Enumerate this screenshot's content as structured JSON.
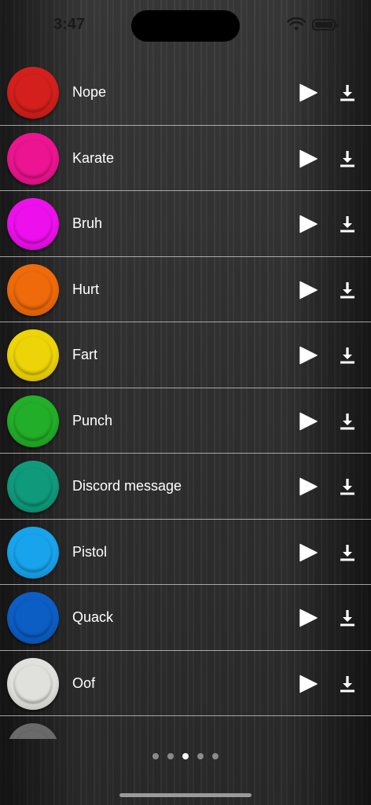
{
  "status_bar": {
    "time": "3:47"
  },
  "sounds": [
    {
      "name": "Nope",
      "color": "#d4201c",
      "rim": "#9f1310"
    },
    {
      "name": "Karate",
      "color": "#ec1490",
      "rim": "#b40a6c"
    },
    {
      "name": "Bruh",
      "color": "#ee10ec",
      "rim": "#b008b0"
    },
    {
      "name": "Hurt",
      "color": "#ee6a0a",
      "rim": "#b44c04"
    },
    {
      "name": "Fart",
      "color": "#ecd408",
      "rim": "#b89e04"
    },
    {
      "name": "Punch",
      "color": "#22ae28",
      "rim": "#14801a"
    },
    {
      "name": "Discord message",
      "color": "#109a7c",
      "rim": "#08725a"
    },
    {
      "name": "Pistol",
      "color": "#18a4ec",
      "rim": "#0c78b4"
    },
    {
      "name": "Quack",
      "color": "#0c5ec4",
      "rim": "#06418f"
    },
    {
      "name": "Oof",
      "color": "#e0e0dc",
      "rim": "#a8a8a4"
    }
  ],
  "partial_item": {
    "color": "#6a6a6a",
    "rim": "#4a4a4a"
  },
  "pager": {
    "page_count": 5,
    "current_page": 3
  },
  "icons": {
    "play": "play-icon",
    "download": "download-icon"
  }
}
